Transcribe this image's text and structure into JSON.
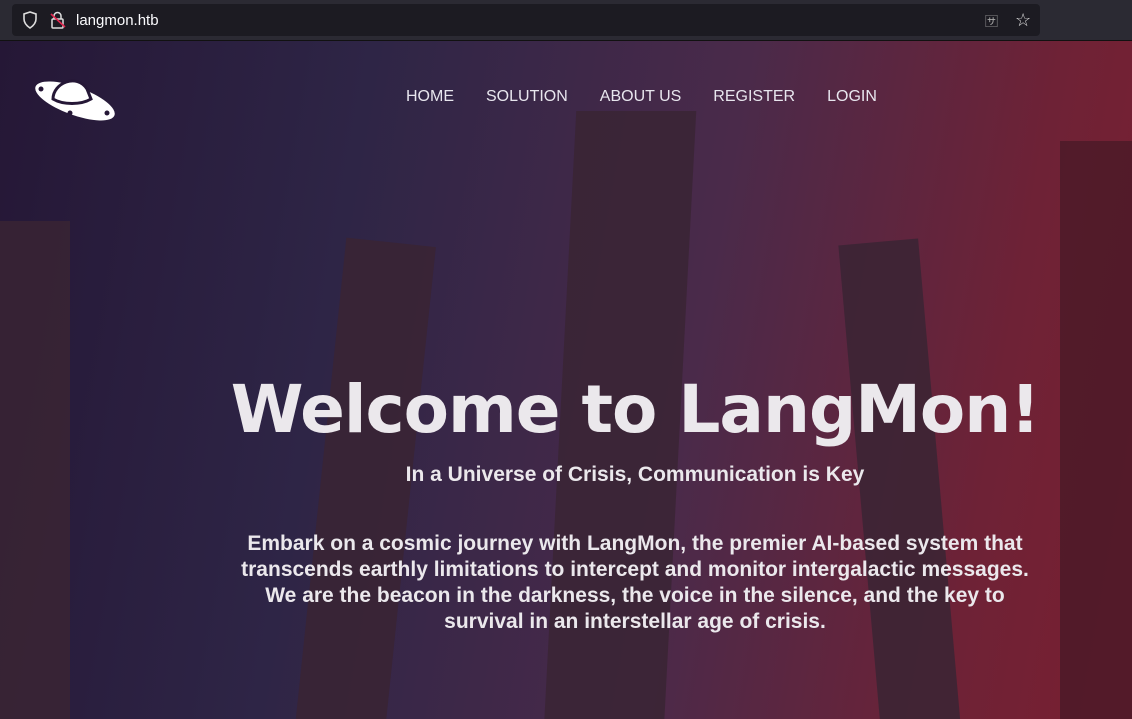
{
  "browser": {
    "url": "langmon.htb",
    "icons": [
      "shield-icon",
      "insecure-lock-icon",
      "translate-icon",
      "bookmark-star-icon"
    ]
  },
  "nav": {
    "items": [
      "HOME",
      "SOLUTION",
      "ABOUT US",
      "REGISTER",
      "LOGIN"
    ]
  },
  "hero": {
    "title": "Welcome to LangMon!",
    "subtitle": "In a Universe of Crisis, Communication is Key",
    "description": "Embark on a cosmic journey with LangMon, the premier AI-based system that transcends earthly limitations to intercept and monitor intergalactic messages. We are the beacon in the darkness, the voice in the silence, and the key to survival in an interstellar age of crisis."
  }
}
